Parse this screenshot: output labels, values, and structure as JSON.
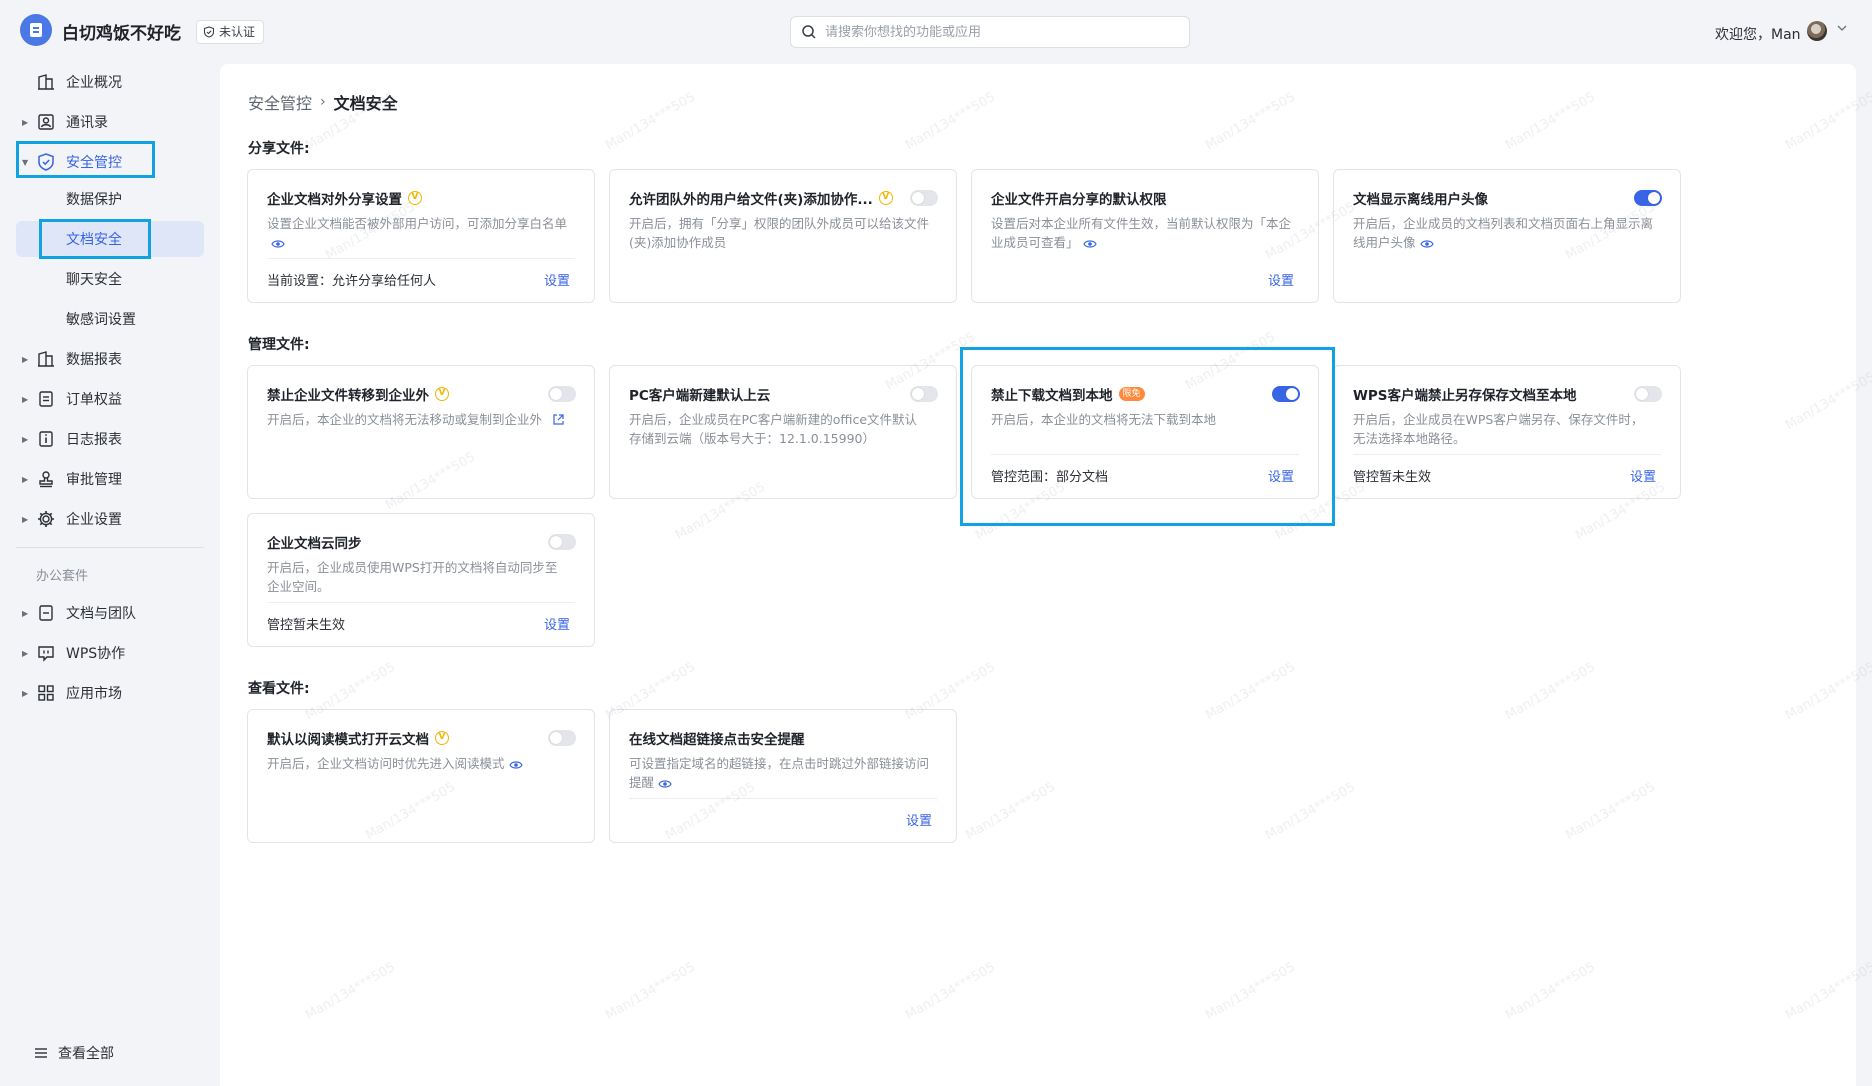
{
  "header": {
    "org_name": "白切鸡饭不好吃",
    "cert_status": "未认证",
    "search_placeholder": "请搜索你想找的功能或应用",
    "welcome": "欢迎您，Man"
  },
  "sidebar": {
    "items": [
      {
        "label": "企业概况",
        "icon": "building-icon"
      },
      {
        "label": "通讯录",
        "icon": "contacts-icon"
      },
      {
        "label": "安全管控",
        "icon": "shield-icon"
      },
      {
        "label": "数据保护"
      },
      {
        "label": "文档安全"
      },
      {
        "label": "聊天安全"
      },
      {
        "label": "敏感词设置"
      },
      {
        "label": "数据报表",
        "icon": "report-icon"
      },
      {
        "label": "订单权益",
        "icon": "order-icon"
      },
      {
        "label": "日志报表",
        "icon": "log-icon"
      },
      {
        "label": "审批管理",
        "icon": "approval-icon"
      },
      {
        "label": "企业设置",
        "icon": "gear-icon"
      }
    ],
    "section_label": "办公套件",
    "suite_items": [
      {
        "label": "文档与团队",
        "icon": "doc-icon"
      },
      {
        "label": "WPS协作",
        "icon": "chat-icon"
      },
      {
        "label": "应用市场",
        "icon": "apps-icon"
      }
    ],
    "view_all": "查看全部"
  },
  "breadcrumb": {
    "parent": "安全管控",
    "current": "文档安全"
  },
  "sections": {
    "share": "分享文件:",
    "manage": "管理文件:",
    "view": "查看文件:"
  },
  "cards": {
    "share_settings": {
      "title": "企业文档对外分享设置",
      "desc": "设置企业文档能否被外部用户访问，可添加分享白名单",
      "status": "当前设置：允许分享给任何人",
      "link": "设置"
    },
    "external_collab": {
      "title": "允许团队外的用户给文件(夹)添加协作...",
      "desc": "开启后，拥有「分享」权限的团队外成员可以给该文件(夹)添加协作成员",
      "toggle_on": false
    },
    "default_share_perm": {
      "title": "企业文件开启分享的默认权限",
      "desc": "设置后对本企业所有文件生效，当前默认权限为「本企业成员可查看」",
      "link": "设置"
    },
    "offline_avatar": {
      "title": "文档显示离线用户头像",
      "desc": "开启后，企业成员的文档列表和文档页面右上角显示离线用户头像",
      "toggle_on": true
    },
    "no_transfer": {
      "title": "禁止企业文件转移到企业外",
      "desc": "开启后，本企业的文档将无法移动或复制到企业外",
      "toggle_on": false
    },
    "pc_cloud_default": {
      "title": "PC客户端新建默认上云",
      "desc": "开启后，企业成员在PC客户端新建的office文件默认存储到云端（版本号大于：12.1.0.15990）",
      "toggle_on": false
    },
    "no_download": {
      "title": "禁止下载文档到本地",
      "badge": "限免",
      "desc": "开启后，本企业的文档将无法下载到本地",
      "status": "管控范围：部分文档",
      "link": "设置",
      "toggle_on": true
    },
    "no_save_as": {
      "title": "WPS客户端禁止另存保存文档至本地",
      "desc": "开启后，企业成员在WPS客户端另存、保存文件时，无法选择本地路径。",
      "status": "管控暂未生效",
      "link": "设置",
      "toggle_on": false
    },
    "cloud_sync": {
      "title": "企业文档云同步",
      "desc": "开启后，企业成员使用WPS打开的文档将自动同步至企业空间。",
      "status": "管控暂未生效",
      "link": "设置",
      "toggle_on": false
    },
    "read_mode": {
      "title": "默认以阅读模式打开云文档",
      "desc": "开启后，企业文档访问时优先进入阅读模式",
      "toggle_on": false
    },
    "link_warning": {
      "title": "在线文档超链接点击安全提醒",
      "desc": "可设置指定域名的超链接，在点击时跳过外部链接访问提醒",
      "link": "设置"
    }
  },
  "watermark_text": "Man/134***505",
  "colors": {
    "accent": "#3864e6",
    "highlight": "#11a2e0",
    "vip": "#f2b600",
    "trial": "#ff8a3c"
  }
}
